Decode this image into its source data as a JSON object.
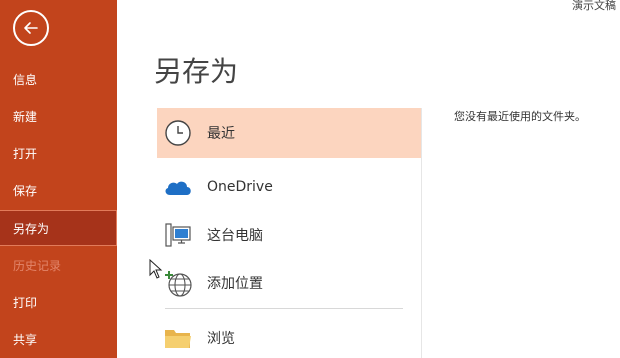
{
  "window": {
    "doc_title": "演示文稿"
  },
  "sidebar": {
    "back_icon": "back-arrow-icon",
    "items": [
      {
        "id": "info",
        "label": "信息"
      },
      {
        "id": "new",
        "label": "新建"
      },
      {
        "id": "open",
        "label": "打开"
      },
      {
        "id": "save",
        "label": "保存"
      },
      {
        "id": "save-as",
        "label": "另存为",
        "active": true
      },
      {
        "id": "history",
        "label": "历史记录",
        "disabled": true
      },
      {
        "id": "print",
        "label": "打印"
      },
      {
        "id": "share",
        "label": "共享"
      }
    ]
  },
  "main": {
    "title": "另存为",
    "locations": [
      {
        "id": "recent",
        "label": "最近",
        "icon": "clock-icon",
        "selected": true
      },
      {
        "id": "onedrive",
        "label": "OneDrive",
        "icon": "cloud-icon"
      },
      {
        "id": "this-pc",
        "label": "这台电脑",
        "icon": "computer-icon"
      },
      {
        "id": "add-place",
        "label": "添加位置",
        "icon": "globe-add-icon"
      },
      {
        "id": "browse",
        "label": "浏览",
        "icon": "folder-icon"
      }
    ],
    "empty_message": "您没有最近使用的文件夹。"
  },
  "colors": {
    "sidebar_bg": "#c2441c",
    "sidebar_active_bg": "#a6331a",
    "selected_bg": "#fcd5bf",
    "onedrive_blue": "#1e6fc5"
  }
}
